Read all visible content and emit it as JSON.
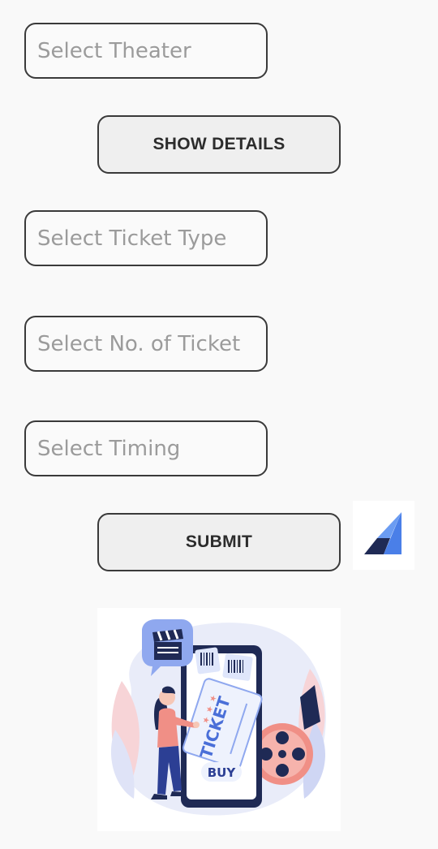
{
  "form": {
    "theater_placeholder": "Select Theater",
    "show_details_label": "SHOW DETAILS",
    "ticket_type_placeholder": "Select Ticket Type",
    "ticket_count_placeholder": "Select No. of Ticket",
    "timing_placeholder": "Select Timing",
    "submit_label": "SUBMIT"
  },
  "illustration": {
    "ticket_text": "TICKET",
    "buy_text": "BUY"
  },
  "colors": {
    "background": "#f9f9f9",
    "border": "#3a3a3a",
    "placeholder": "#9b9b9b",
    "accent_blue": "#4a7fe8",
    "navy": "#1f2a55",
    "coral": "#f08f86"
  },
  "icons": [
    "app-logo-icon",
    "clapperboard-icon",
    "film-reel-icon"
  ]
}
